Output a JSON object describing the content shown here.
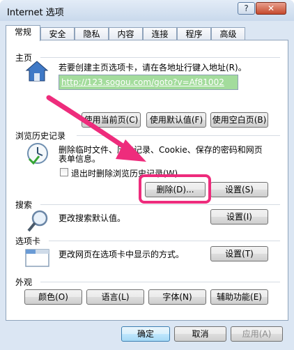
{
  "window": {
    "title": "Internet 选项",
    "help": "?",
    "close": "✕"
  },
  "tabs": [
    "常规",
    "安全",
    "隐私",
    "内容",
    "连接",
    "程序",
    "高级"
  ],
  "home": {
    "section": "主页",
    "desc": "若要创建主页选项卡，请在各地址行键入地址(R)。",
    "url": "http://123.sogou.com/goto?v=Af81002",
    "btn_current": "使用当前页(C)",
    "btn_default": "使用默认值(F)",
    "btn_blank": "使用空白页(B)"
  },
  "history": {
    "section": "浏览历史记录",
    "desc1": "删除临时文件、历史记录、Cookie、保存的密码和网页",
    "desc2": "表单信息。",
    "checkbox": "退出时删除浏览历史记录(W)",
    "btn_delete": "删除(D)...",
    "btn_settings": "设置(S)"
  },
  "search": {
    "section": "搜索",
    "desc": "更改搜索默认值。",
    "btn_settings": "设置(I)"
  },
  "tabsec": {
    "section": "选项卡",
    "desc": "更改网页在选项卡中显示的方式。",
    "btn_settings": "设置(T)"
  },
  "appearance": {
    "section": "外观",
    "btn_colors": "颜色(O)",
    "btn_languages": "语言(L)",
    "btn_fonts": "字体(N)",
    "btn_access": "辅助功能(E)"
  },
  "footer": {
    "ok": "确定",
    "cancel": "取消",
    "apply": "应用(A)"
  },
  "colors": {
    "highlight": "#ee2c7c",
    "url_bg": "#a3dc9c"
  },
  "icons": [
    "help-icon",
    "close-icon",
    "home-icon",
    "history-icon",
    "search-icon",
    "tabs-icon"
  ]
}
